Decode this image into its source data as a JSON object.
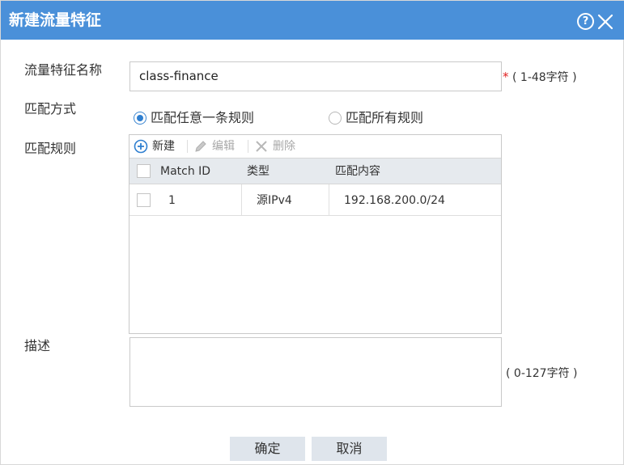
{
  "dialog": {
    "title": "新建流量特征",
    "help_symbol": "?"
  },
  "form": {
    "name_label": "流量特征名称",
    "name_value": "class-finance",
    "required_mark": "*",
    "name_hint": "( 1-48字符 )",
    "match_mode_label": "匹配方式",
    "match_any_label": "匹配任意一条规则",
    "match_all_label": "匹配所有规则",
    "selected_match_mode": "匹配任意一条规则",
    "rules_label": "匹配规则",
    "description_label": "描述",
    "description_value": "",
    "description_hint": "( 0-127字符 )"
  },
  "toolbar": {
    "new_label": "新建",
    "edit_label": "编辑",
    "delete_label": "删除"
  },
  "rules_table": {
    "columns": [
      "Match ID",
      "类型",
      "匹配内容"
    ],
    "rows": [
      {
        "match_id": "1",
        "type": "源IPv4",
        "content": "192.168.200.0/24"
      }
    ]
  },
  "footer": {
    "ok_label": "确定",
    "cancel_label": "取消"
  },
  "colors": {
    "title_bar": "#4a90d9",
    "radio_selected": "#2f7fd0",
    "required": "#e02020",
    "button_bg": "#dfe5ec",
    "table_header_bg": "#e6eaee"
  }
}
